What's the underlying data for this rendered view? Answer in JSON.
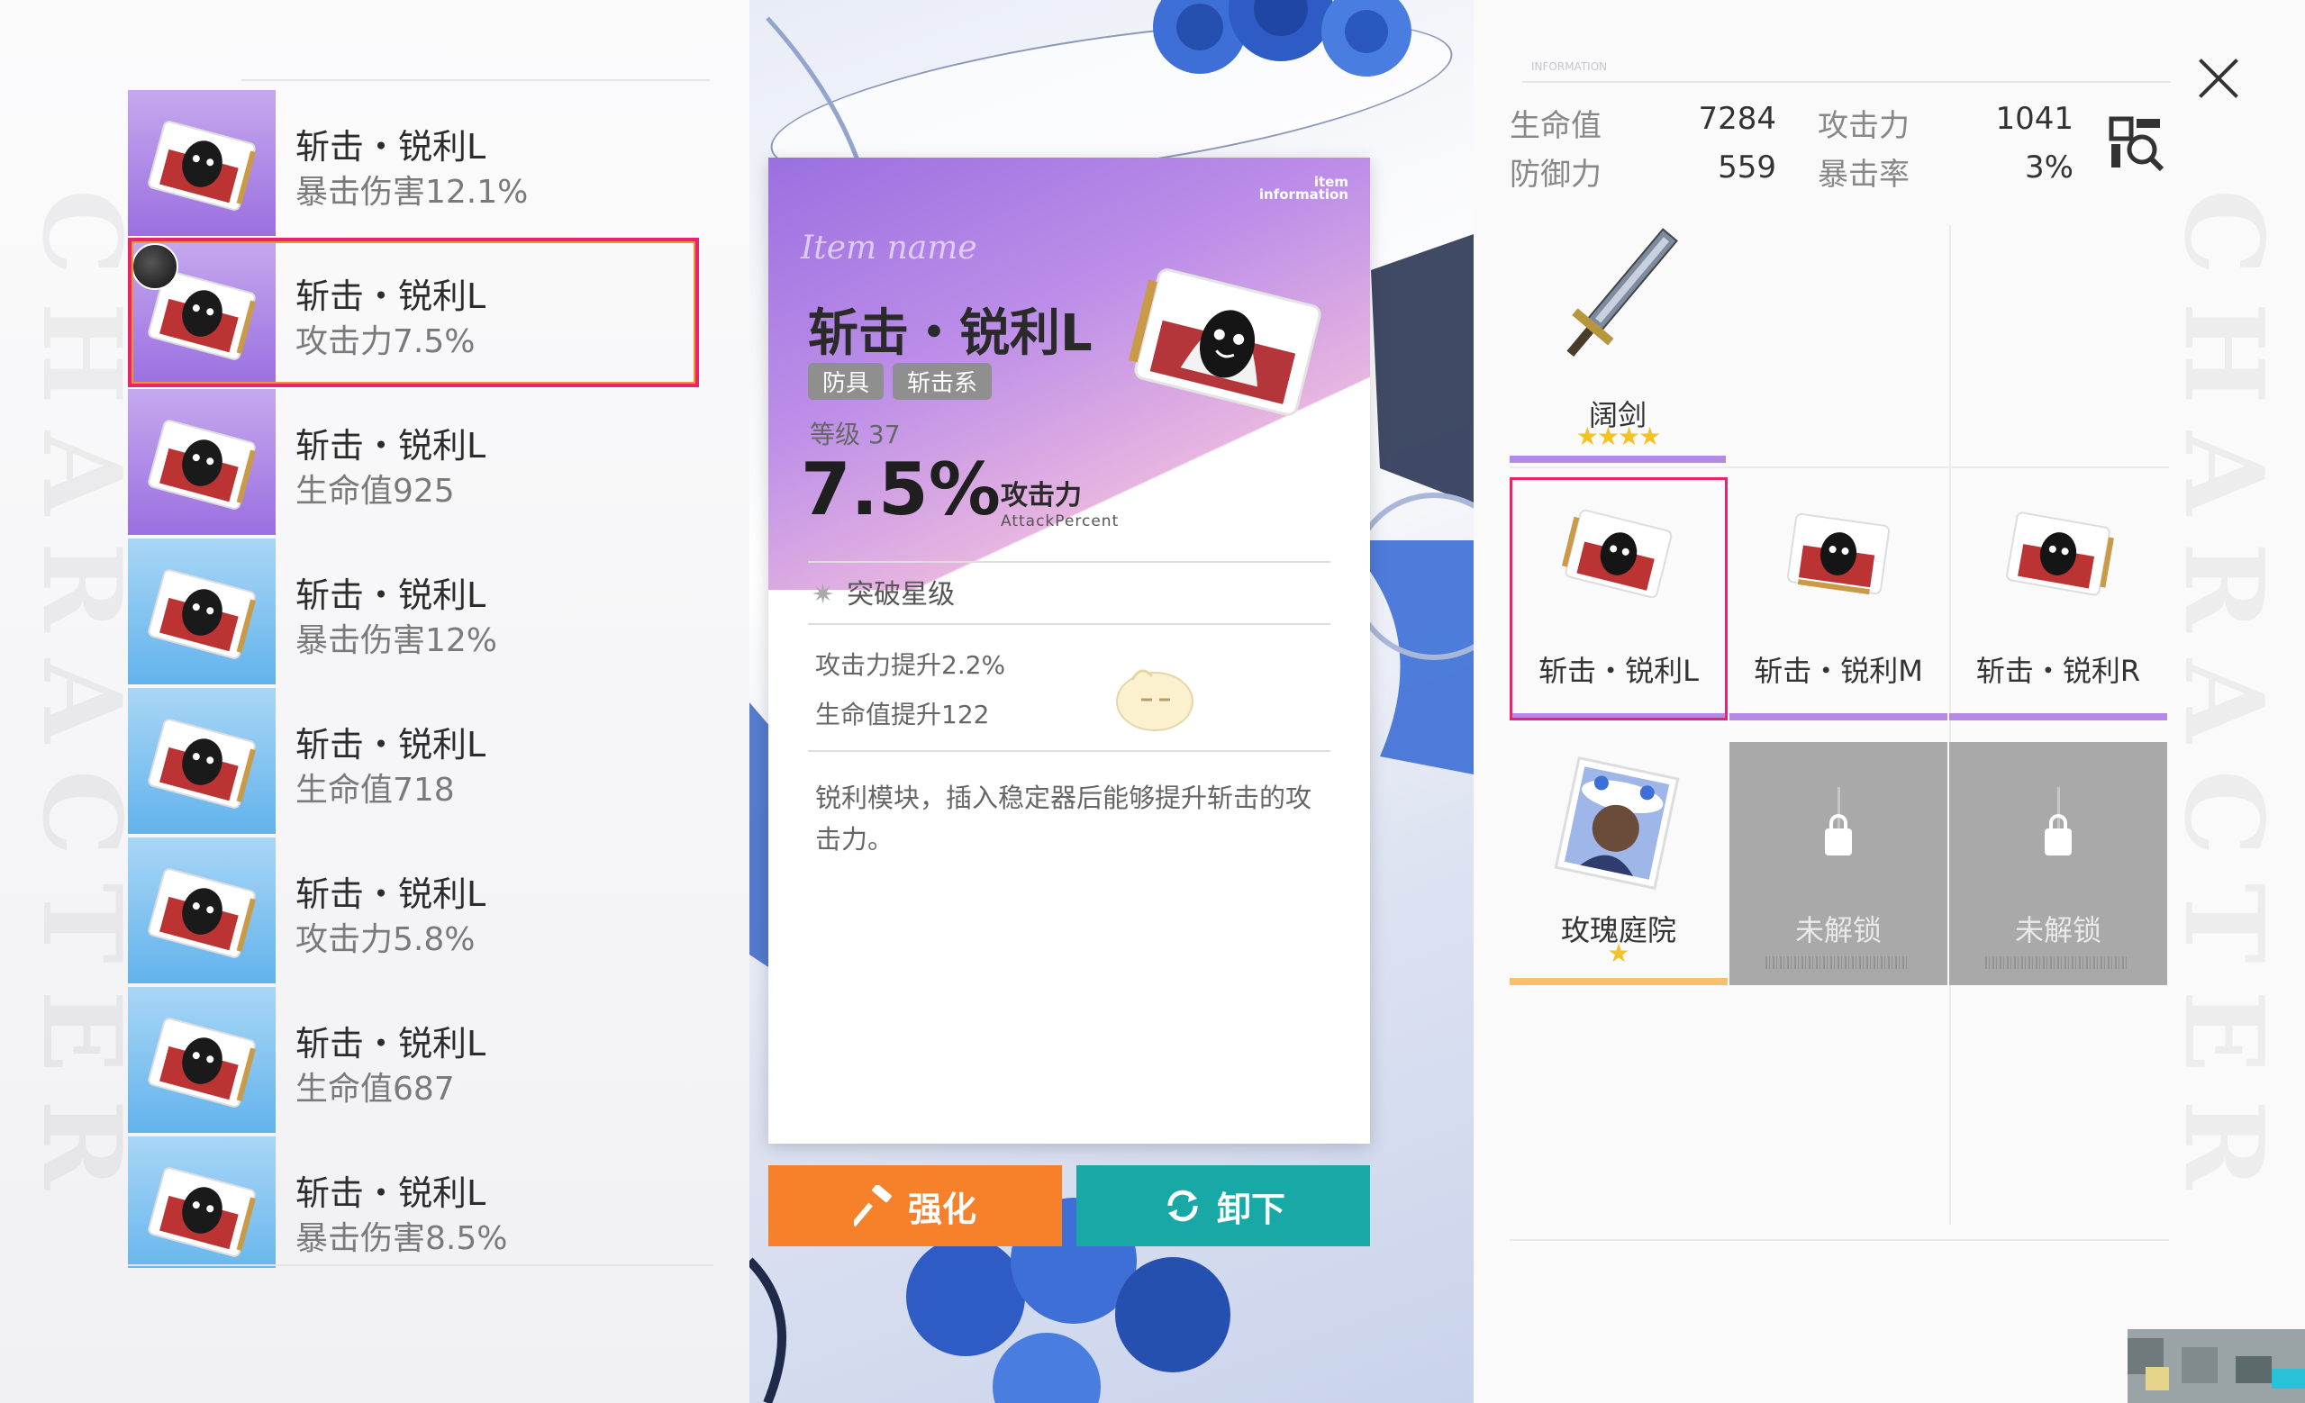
{
  "deco_text": "CHARACTER",
  "list": {
    "items": [
      {
        "name": "斩击・锐利L",
        "stat": "暴击伤害12.1%",
        "color": "purple"
      },
      {
        "name": "斩击・锐利L",
        "stat": "攻击力7.5%",
        "color": "purple",
        "selected": true
      },
      {
        "name": "斩击・锐利L",
        "stat": "生命值925",
        "color": "purple"
      },
      {
        "name": "斩击・锐利L",
        "stat": "暴击伤害12%",
        "color": "blue"
      },
      {
        "name": "斩击・锐利L",
        "stat": "生命值718",
        "color": "blue"
      },
      {
        "name": "斩击・锐利L",
        "stat": "攻击力5.8%",
        "color": "blue"
      },
      {
        "name": "斩击・锐利L",
        "stat": "生命值687",
        "color": "blue"
      },
      {
        "name": "斩击・锐利L",
        "stat": "暴击伤害8.5%",
        "color": "blue"
      }
    ]
  },
  "card": {
    "info_tag_line1": "item",
    "info_tag_line2": "information",
    "script_label": "Item name",
    "title": "斩击・锐利L",
    "tags": [
      "防具",
      "斩击系"
    ],
    "level_label": "等级 37",
    "main_value": "7.5%",
    "main_attr_cn": "攻击力",
    "main_attr_en": "AttackPercent",
    "breakthrough_label": "突破星级",
    "bonus1": "攻击力提升2.2%",
    "bonus2": "生命值提升122",
    "description": "锐利模块，插入稳定器后能够提升斩击的攻击力。"
  },
  "buttons": {
    "upgrade": "强化",
    "unequip": "卸下"
  },
  "stats": {
    "info_title": "INFORMATION",
    "hp_label": "生命值",
    "hp_value": "7284",
    "atk_label": "攻击力",
    "atk_value": "1041",
    "def_label": "防御力",
    "def_value": "559",
    "crit_label": "暴击率",
    "crit_value": "3%"
  },
  "weapon": {
    "name": "阔剑",
    "stars": "★★★★"
  },
  "slots": [
    {
      "name": "斩击・锐利L",
      "selected": true
    },
    {
      "name": "斩击・锐利M"
    },
    {
      "name": "斩击・锐利R"
    }
  ],
  "extra_slots": [
    {
      "name": "玫瑰庭院",
      "stars": "★"
    },
    {
      "name": "未解锁"
    },
    {
      "name": "未解锁"
    }
  ],
  "colors": {
    "select_border": "#e8246a",
    "upgrade_btn": "#f7802b",
    "unequip_btn": "#18a9a7",
    "purple_rarity": "#9b6fe0",
    "blue_rarity": "#62b3ec",
    "gold_bar": "#f5c26b"
  }
}
